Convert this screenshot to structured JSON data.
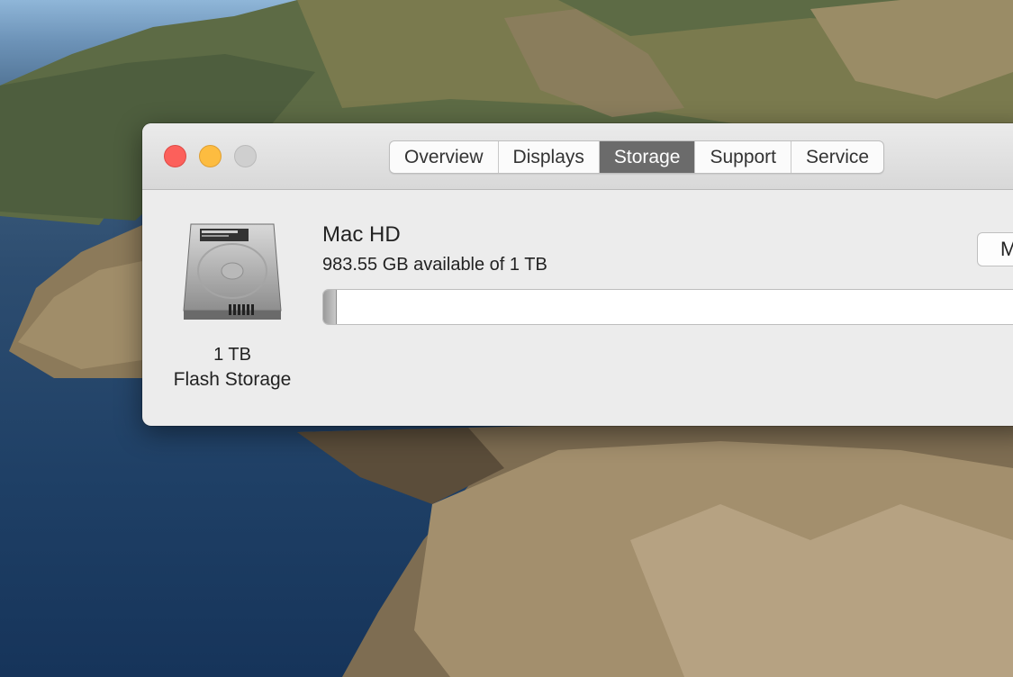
{
  "window": {
    "tabs": [
      "Overview",
      "Displays",
      "Storage",
      "Support",
      "Service"
    ],
    "active_tab": "Storage"
  },
  "storage": {
    "drive_capacity": "1 TB",
    "drive_type": "Flash Storage",
    "volume_name": "Mac HD",
    "available_text": "983.55 GB available of 1 TB",
    "used_fraction": 0.0164,
    "manage_button_label": "M"
  },
  "colors": {
    "close": "#fc605b",
    "minimize": "#fdbc40",
    "zoom_disabled": "#cfcfcf",
    "active_tab": "#6b6b6b"
  }
}
